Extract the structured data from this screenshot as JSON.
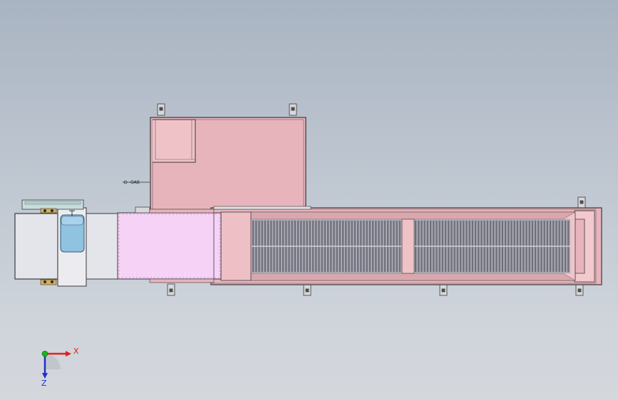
{
  "viewport": {
    "background_top": "#a9b4c2",
    "background_bottom": "#d4d7dc"
  },
  "model": {
    "colors": {
      "pink_body": "#e8b4bc",
      "pink_light": "#f2c9cf",
      "magenta_panel": "#f7d2f7",
      "grey_panel": "#e4e5ea",
      "cylinder_blue": "#8fc3e0",
      "grate": "#7c7c88",
      "outline": "#3a3a3a"
    },
    "annotation_text": "OAB"
  },
  "triad": {
    "x_label": "X",
    "z_label": "Z",
    "x_color": "#e02020",
    "z_color": "#2030c8",
    "y_color": "#20b020"
  }
}
